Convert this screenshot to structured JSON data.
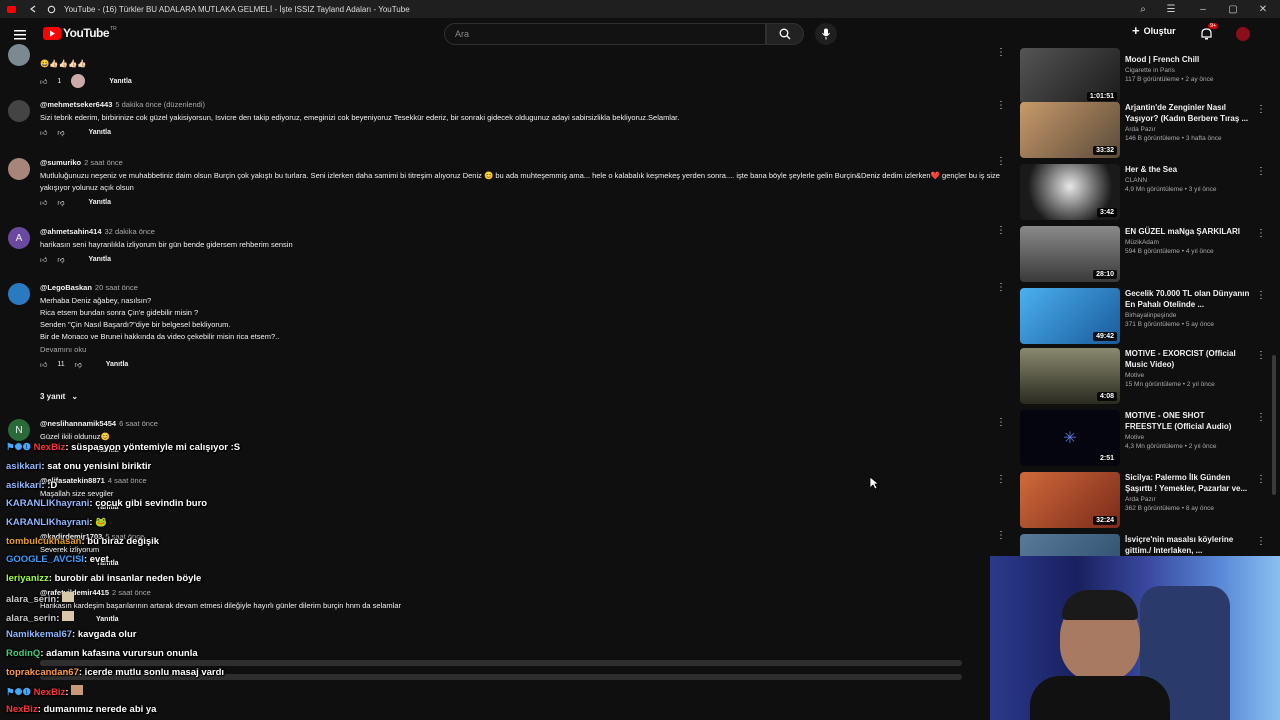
{
  "window": {
    "title": "YouTube - (16) Türkler BU ADALARA MUTLAKA GELMELİ - İşte ISSIZ Tayland Adaları - YouTube"
  },
  "header": {
    "logo_text": "YouTube",
    "logo_country": "TR",
    "search_placeholder": "Ara",
    "create_label": "Oluştur",
    "notification_count": "9+"
  },
  "comments": [
    {
      "author": "",
      "time": "",
      "text": "😀👍🏻👍🏻👍🏻👍🏻",
      "likes": "1",
      "reply": "Yanıtla"
    },
    {
      "author": "@mehmetseker6443",
      "time": "5 dakika önce (düzenlendi)",
      "text": "Sizi tebrik ederim, birbirinize cok güzel yakisiyorsun, Isvicre den takip ediyoruz, emeginizi cok beyeniyoruz Tesekkür ederiz, bir sonraki gidecek oldugunuz adayi sabirsizlikla bekliyoruz.Selamlar.",
      "likes": "",
      "reply": "Yanıtla"
    },
    {
      "author": "@sumuriko",
      "time": "2 saat önce",
      "text": "Mutluluğunuzu neşeniz ve muhabbetiniz daim olsun Burçin çok yakıştı bu turlara. Seni izlerken daha samimi bi titreşim alıyoruz Deniz 😊 bu ada muhteşemmiş ama... hele o kalabalık keşmekeş yerden sonra.... işte bana böyle şeylerle gelin Burçin&Deniz dedim izlerken❤️ gençler bu iş size yakışıyor yolunuz açık olsun",
      "likes": "",
      "reply": "Yanıtla"
    },
    {
      "author": "@ahmetsahin414",
      "time": "32 dakika önce",
      "text": "harikasın seni hayranlıkla izliyorum bir gün bende gidersem rehberim sensin",
      "likes": "",
      "reply": "Yanıtla"
    },
    {
      "author": "@LegoBaskan",
      "time": "20 saat önce",
      "lines": [
        "Merhaba Deniz ağabey, nasılsın?",
        "Rica etsem bundan sonra Çin'e gidebilir misin ?",
        "Senden \"Çin Nasıl Başardı?\"diye bir belgesel bekliyorum.",
        "Bir de Monaco ve Brunei hakkında da video çekebilir misin rica etsem?.."
      ],
      "more": "Devamını oku",
      "likes": "11",
      "reply": "Yanıtla",
      "replies": "3 yanıt"
    },
    {
      "author": "@neslihannamik5454",
      "time": "6 saat önce",
      "text": "Güzel ikili oldunuz😊",
      "reply": "Yanıtla"
    },
    {
      "author": "@elifasatekin8871",
      "time": "4 saat önce",
      "text": "Maşallah size sevgiler",
      "reply": "Yanıtla"
    },
    {
      "author": "@kadirdemir1703",
      "time": "5 saat önce",
      "text": "Severek izliyorum",
      "reply": "Yanıtla"
    },
    {
      "author": "@rafetyildemir4415",
      "time": "2 saat önce",
      "text": "Harikasın kardeşim başarılarının artarak devam etmesi dileğiyle hayırlı günler dilerim burçin hnm  da selamlar",
      "reply": "Yanıtla"
    }
  ],
  "sidebar": [
    {
      "title": "Mood | French Chill",
      "channel": "Cigarette in Paris",
      "meta": "117 B görüntüleme • 2 ay önce",
      "duration": "1:01:51",
      "color": "#3a3a3a"
    },
    {
      "title": "Arjantin'de Zenginler Nasıl Yaşıyor? (Kadın Berbere Tıraş ...",
      "channel": "Arda Pazır",
      "meta": "146 B görüntüleme • 3 hafta önce",
      "duration": "33:32",
      "color": "#8a6a4a"
    },
    {
      "title": "Her & the Sea",
      "channel": "CLANN",
      "meta": "4,9 Mn görüntüleme • 3 yıl önce",
      "duration": "3:42",
      "color": "#cfcfcf"
    },
    {
      "title": "EN GÜZEL maNga ŞARKILARI",
      "channel": "MüzikAdam",
      "meta": "594 B görüntüleme • 4 yıl önce",
      "duration": "28:10",
      "color": "#5a6060"
    },
    {
      "title": "Gecelik 70.000 TL olan Dünyanın En Pahalı Otelinde ...",
      "channel": "Birhayalinpeşinde",
      "meta": "371 B görüntüleme • 5 ay önce",
      "duration": "49:42",
      "color": "#2a88c8"
    },
    {
      "title": "MOTIVE - EXORCIST (Official Music Video)",
      "channel": "Motive",
      "meta": "15 Mn görüntüleme • 2 yıl önce",
      "duration": "4:08",
      "color": "#6a6a50"
    },
    {
      "title": "MOTIVE - ONE SHOT FREESTYLE (Official Audio)",
      "channel": "Motive",
      "meta": "4,3 Mn görüntüleme • 2 yıl önce",
      "duration": "2:51",
      "color": "#0a0a18"
    },
    {
      "title": "Sicilya: Palermo İlk Günden Şaşırttı ! Yemekler, Pazarlar ve...",
      "channel": "Arda Pazır",
      "meta": "362 B görüntüleme • 8 ay önce",
      "duration": "32:24",
      "color": "#b04a2a"
    },
    {
      "title": "İsviçre'nin masalsı köylerine gittim./ Interlaken, ...",
      "channel": "",
      "meta": "",
      "duration": "",
      "color": "#3a5a7a"
    }
  ],
  "chat": [
    {
      "user": "NexBiz",
      "msg": ": süspasyon yöntemiyle mi calışıyor :S",
      "color": "#ff3333"
    },
    {
      "user": "asikkari",
      "msg": ": sat onu yenisini biriktir",
      "color": "#8fb7ff"
    },
    {
      "user": "asikkari",
      "msg": ": :D",
      "color": "#8fb7ff"
    },
    {
      "user": "KARANLIKhayrani",
      "msg": ": cocuk gibi sevindin buro",
      "color": "#8fb7ff"
    },
    {
      "user": "KARANLIKhayrani",
      "msg": ":",
      "color": "#8fb7ff"
    },
    {
      "user": "tombulcukhasan",
      "msg": ": bu biraz değişik",
      "color": "#e8a020"
    },
    {
      "user": "GOOGLE_AVCISI",
      "msg": ": evet",
      "color": "#3aa0ff"
    },
    {
      "user": "leriyanizz",
      "msg": ": burobir abi insanlar neden böyle",
      "color": "#a0ff40"
    },
    {
      "user": "alara_serin",
      "msg": ":",
      "color": "#c8c8c8"
    },
    {
      "user": "alara_serin",
      "msg": ":",
      "color": "#c8c8c8"
    },
    {
      "user": "Namikkemal67",
      "msg": ": kavgada olur",
      "color": "#8fb7ff"
    },
    {
      "user": "RodinQ",
      "msg": ": adamın kafasına vurursun onunla",
      "color": "#3ad07a"
    },
    {
      "user": "toprakcandan67",
      "msg": ": icerde mutlu sonlu masaj vardı",
      "color": "#ff9a40"
    },
    {
      "user": "NexBiz",
      "msg": ":",
      "color": "#ff3333"
    },
    {
      "user": "NexBiz",
      "msg": ": dumanımız nerede abi ya",
      "color": "#ff3333"
    }
  ]
}
